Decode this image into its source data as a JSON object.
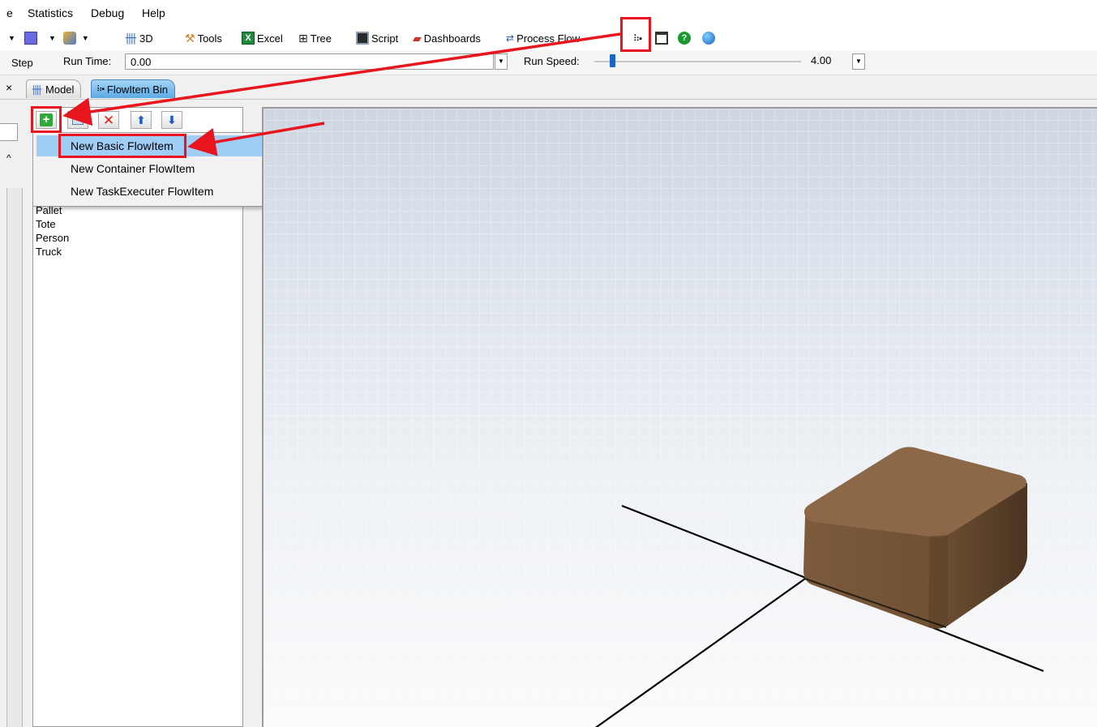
{
  "menu": {
    "items": [
      "e",
      "Statistics",
      "Debug",
      "Help"
    ]
  },
  "toolbar": {
    "btn_3d": "3D",
    "btn_tools": "Tools",
    "btn_excel": "Excel",
    "btn_tree": "Tree",
    "btn_script": "Script",
    "btn_dashboards": "Dashboards",
    "btn_processflow": "Process Flow"
  },
  "runbar": {
    "step_label": "Step",
    "run_time_label": "Run Time:",
    "run_time_value": "0.00",
    "run_speed_label": "Run Speed:",
    "run_speed_value": "4.00"
  },
  "tabs": [
    {
      "label": "Model"
    },
    {
      "label": "FlowItem Bin"
    }
  ],
  "panel_close": "×",
  "flowitems": [
    "Pallet",
    "Tote",
    "Person",
    "Truck"
  ],
  "dropdown": {
    "items": [
      "New Basic FlowItem",
      "New Container FlowItem",
      "New TaskExecuter FlowItem"
    ],
    "selected": "New Basic FlowItem"
  },
  "colors": {
    "highlight": "#e8141e",
    "menu_hover": "#9fcdf5",
    "box": "#8a6545",
    "accent": "#1e64c8"
  },
  "icons": [
    "plus-icon",
    "duplicate-icon",
    "delete-icon",
    "arrow-up-icon",
    "arrow-down-icon",
    "flowitem-bin-icon",
    "window-icon",
    "help-icon",
    "globe-icon"
  ]
}
